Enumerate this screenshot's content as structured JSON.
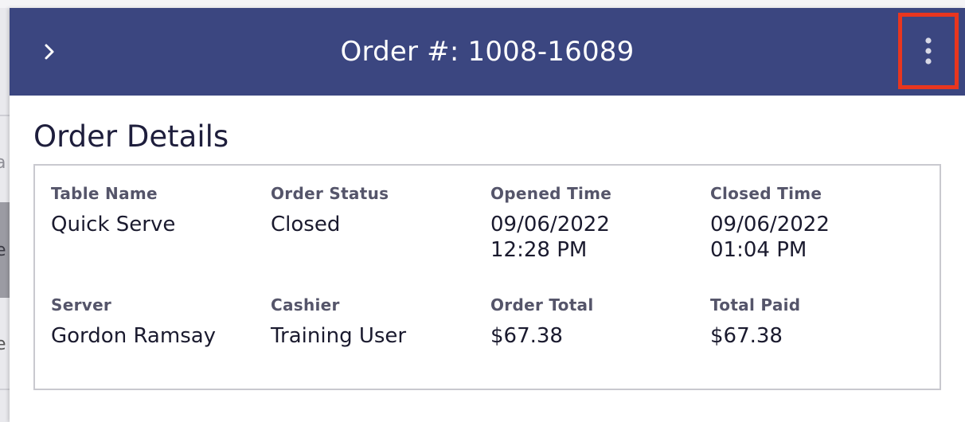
{
  "header": {
    "title": "Order #: 1008-16089",
    "background_color": "#3b4680",
    "highlight_color": "#e8361f"
  },
  "section": {
    "title": "Order Details"
  },
  "details": {
    "table_name": {
      "label": "Table Name",
      "value": "Quick Serve"
    },
    "order_status": {
      "label": "Order Status",
      "value": "Closed"
    },
    "opened_time": {
      "label": "Opened Time",
      "date": "09/06/2022",
      "time": "12:28 PM"
    },
    "closed_time": {
      "label": "Closed Time",
      "date": "09/06/2022",
      "time": "01:04 PM"
    },
    "server": {
      "label": "Server",
      "value": "Gordon Ramsay"
    },
    "cashier": {
      "label": "Cashier",
      "value": "Training User"
    },
    "order_total": {
      "label": "Order Total",
      "value": "$67.38"
    },
    "total_paid": {
      "label": "Total Paid",
      "value": "$67.38"
    }
  },
  "background": {
    "fragments": [
      "a",
      "e",
      "e"
    ]
  },
  "icons": {
    "collapse": "chevron-right-icon",
    "menu": "more-vertical-icon"
  }
}
